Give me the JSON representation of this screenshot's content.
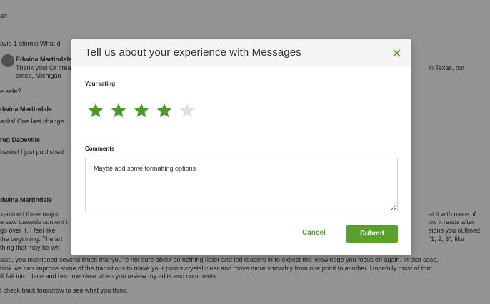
{
  "background": {
    "lines": [
      "ari",
      "avid 1 storms   What d",
      "Edwina Martindale",
      "Thank you! Or brea",
      "ented, Michigan",
      "in Texas, but",
      "at it with more of",
      "ow it reads after",
      "sions you outlined",
      "\"1, 2, 3\", like",
      "e safe?",
      "dwina Martindale",
      "anks! One last change",
      "reg Dabeville",
      "hanks! I just published",
      "dwina Martindale",
      "xamined three major",
      "e saw towards content t",
      "go over it, I feel like",
      "the beginning. The art",
      "thing that may be wh",
      "also, you mentioned several times that you're not sure about something (later and led readers in to expect the knowledge you focus on again. In that case, I",
      "hink we can improve some of the transitions to make your points crystal clear and move more smoothly from one point to another. Hopefully most of that",
      "ill fall into place and become clear when you review my edits and comments.",
      "l check back tomorrow to see what you think."
    ]
  },
  "modal": {
    "title": "Tell us about your experience with Messages",
    "close_label": "×",
    "rating_label": "Your rating",
    "rating": {
      "value": 4,
      "max": 5
    },
    "comments_label": "Comments",
    "comments_value": "Maybe add some formatting options",
    "cancel_label": "Cancel",
    "submit_label": "Submit"
  },
  "colors": {
    "accent": "#5aa02c",
    "star_filled": "#4c9a2a",
    "star_empty": "#e0e0e0",
    "overlay": "rgba(0,0,0,0.42)"
  }
}
